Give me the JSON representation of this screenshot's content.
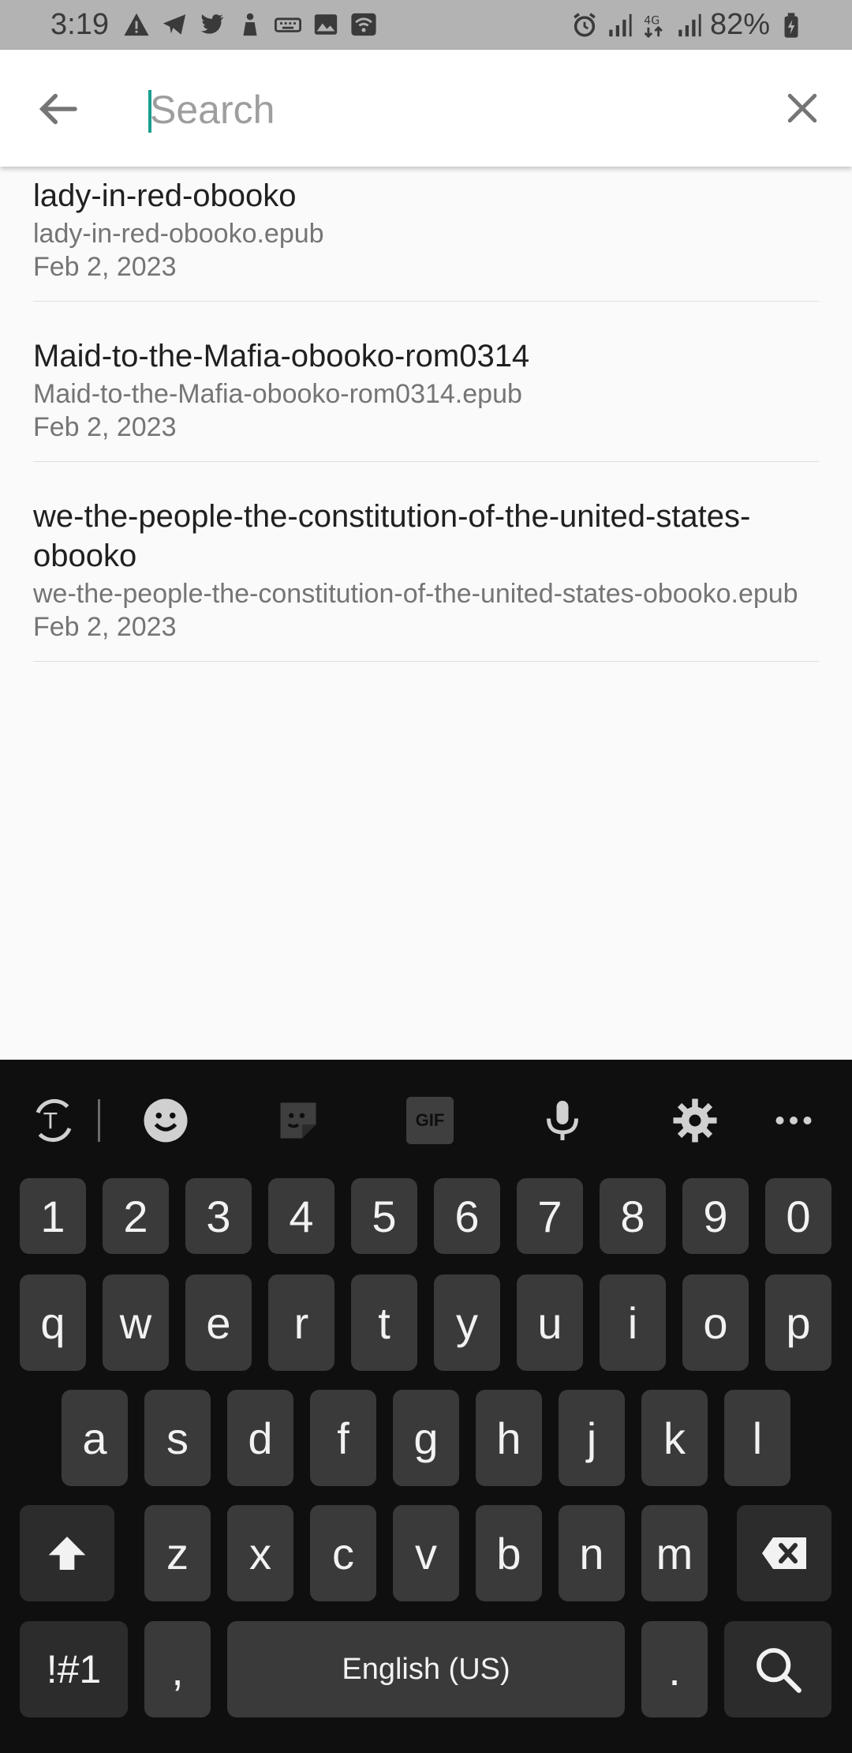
{
  "status_bar": {
    "time": "3:19",
    "battery": "82%"
  },
  "search": {
    "placeholder": "Search",
    "value": ""
  },
  "results": [
    {
      "title": "lady-in-red-obooko",
      "file": "lady-in-red-obooko.epub",
      "date": "Feb 2, 2023"
    },
    {
      "title": "Maid-to-the-Mafia-obooko-rom0314",
      "file": "Maid-to-the-Mafia-obooko-rom0314.epub",
      "date": "Feb 2, 2023"
    },
    {
      "title": "we-the-people-the-constitution-of-the-united-states-obooko",
      "file": "we-the-people-the-constitution-of-the-united-states-obooko.epub",
      "date": "Feb 2, 2023"
    }
  ],
  "keyboard": {
    "toolbar_icons": [
      "translate-icon",
      "emoji-icon",
      "sticker-icon",
      "gif-icon",
      "microphone-icon",
      "settings-icon",
      "more-icon"
    ],
    "gif_label": "GIF",
    "number_row": [
      "1",
      "2",
      "3",
      "4",
      "5",
      "6",
      "7",
      "8",
      "9",
      "0"
    ],
    "row1": [
      "q",
      "w",
      "e",
      "r",
      "t",
      "y",
      "u",
      "i",
      "o",
      "p"
    ],
    "row2": [
      "a",
      "s",
      "d",
      "f",
      "g",
      "h",
      "j",
      "k",
      "l"
    ],
    "row3": [
      "z",
      "x",
      "c",
      "v",
      "b",
      "n",
      "m"
    ],
    "symbols_label": "!#1",
    "comma_label": ",",
    "space_label": "English (US)",
    "period_label": "."
  },
  "colors": {
    "accent": "#1a9e8f",
    "keyboard_bg": "#0f0f0f",
    "key_bg": "#3a3a3a"
  }
}
